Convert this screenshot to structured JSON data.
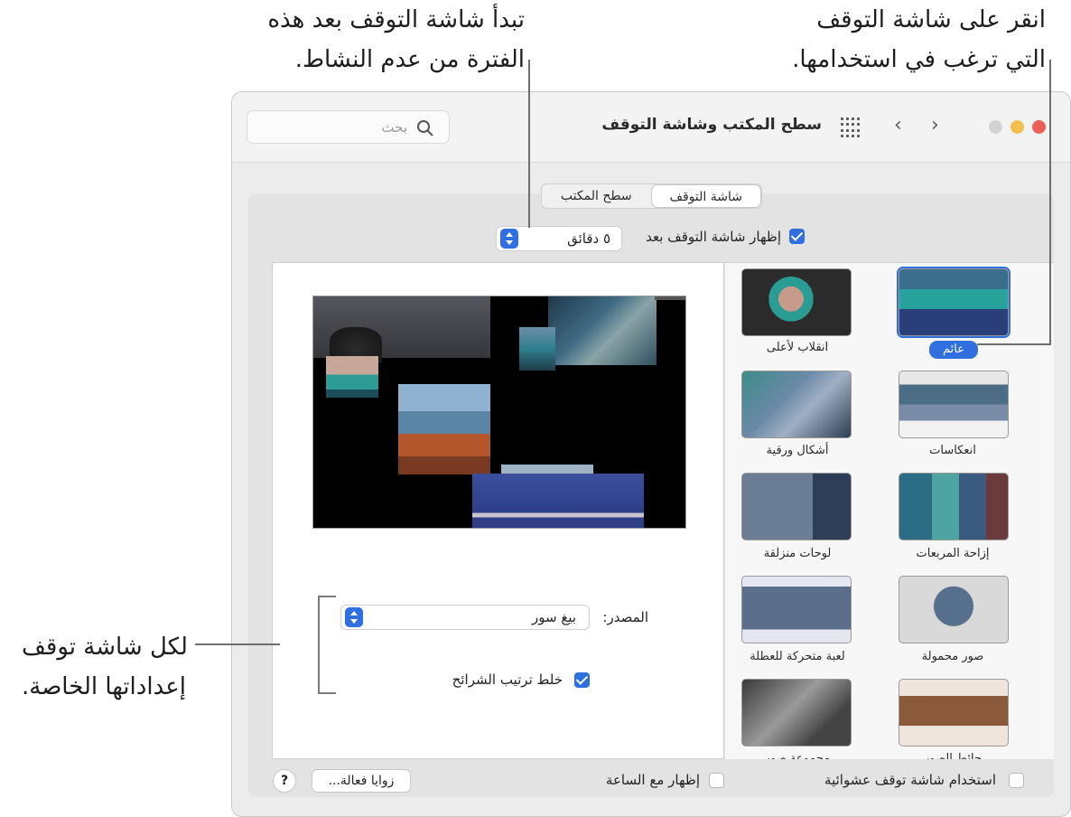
{
  "callouts": {
    "top_right_line1": "انقر على شاشة التوقف",
    "top_right_line2": "التي ترغب في استخدامها.",
    "top_center_line1": "تبدأ شاشة التوقف بعد هذه",
    "top_center_line2": "الفترة من عدم النشاط.",
    "left_line1": "لكل شاشة توقف",
    "left_line2": "إعداداتها الخاصة."
  },
  "window": {
    "title": "سطح المكتب وشاشة التوقف",
    "back": "‹",
    "forward": "›",
    "search_placeholder": "بحث"
  },
  "tabs": [
    "سطح المكتب",
    "شاشة التوقف"
  ],
  "selected_tab": "شاشة التوقف",
  "show_after": {
    "label": "إظهار شاشة التوقف بعد",
    "value": "٥ دقائق",
    "checked": true
  },
  "screensavers": [
    {
      "label": "عائم",
      "selected": true
    },
    {
      "label": "انقلاب لأعلى",
      "selected": false
    },
    {
      "label": "انعكاسات",
      "selected": false
    },
    {
      "label": "أشكال ورقية",
      "selected": false
    },
    {
      "label": "إزاحة المربعات",
      "selected": false
    },
    {
      "label": "لوحات منزلقة",
      "selected": false
    },
    {
      "label": "صور محمولة",
      "selected": false
    },
    {
      "label": "لعبة متحركة للعطلة",
      "selected": false
    },
    {
      "label": "حائط الصور",
      "selected": false
    },
    {
      "label": "مجموعة صور",
      "selected": false
    }
  ],
  "options": {
    "source_label": "المصدر:",
    "source_value": "بيغ سور",
    "shuffle_label": "خلط ترتيب الشرائح",
    "shuffle_checked": true
  },
  "bottom": {
    "random_label": "استخدام شاشة توقف عشوائية",
    "random_checked": false,
    "clock_label": "إظهار مع الساعة",
    "clock_checked": false,
    "hot_corners": "زوايا فعالة...",
    "help": "?"
  },
  "colors": {
    "accent": "#2f6fe0",
    "close": "#ec5f57",
    "minimize": "#f4bf4f",
    "zoom_disabled": "#d3d3d3"
  }
}
